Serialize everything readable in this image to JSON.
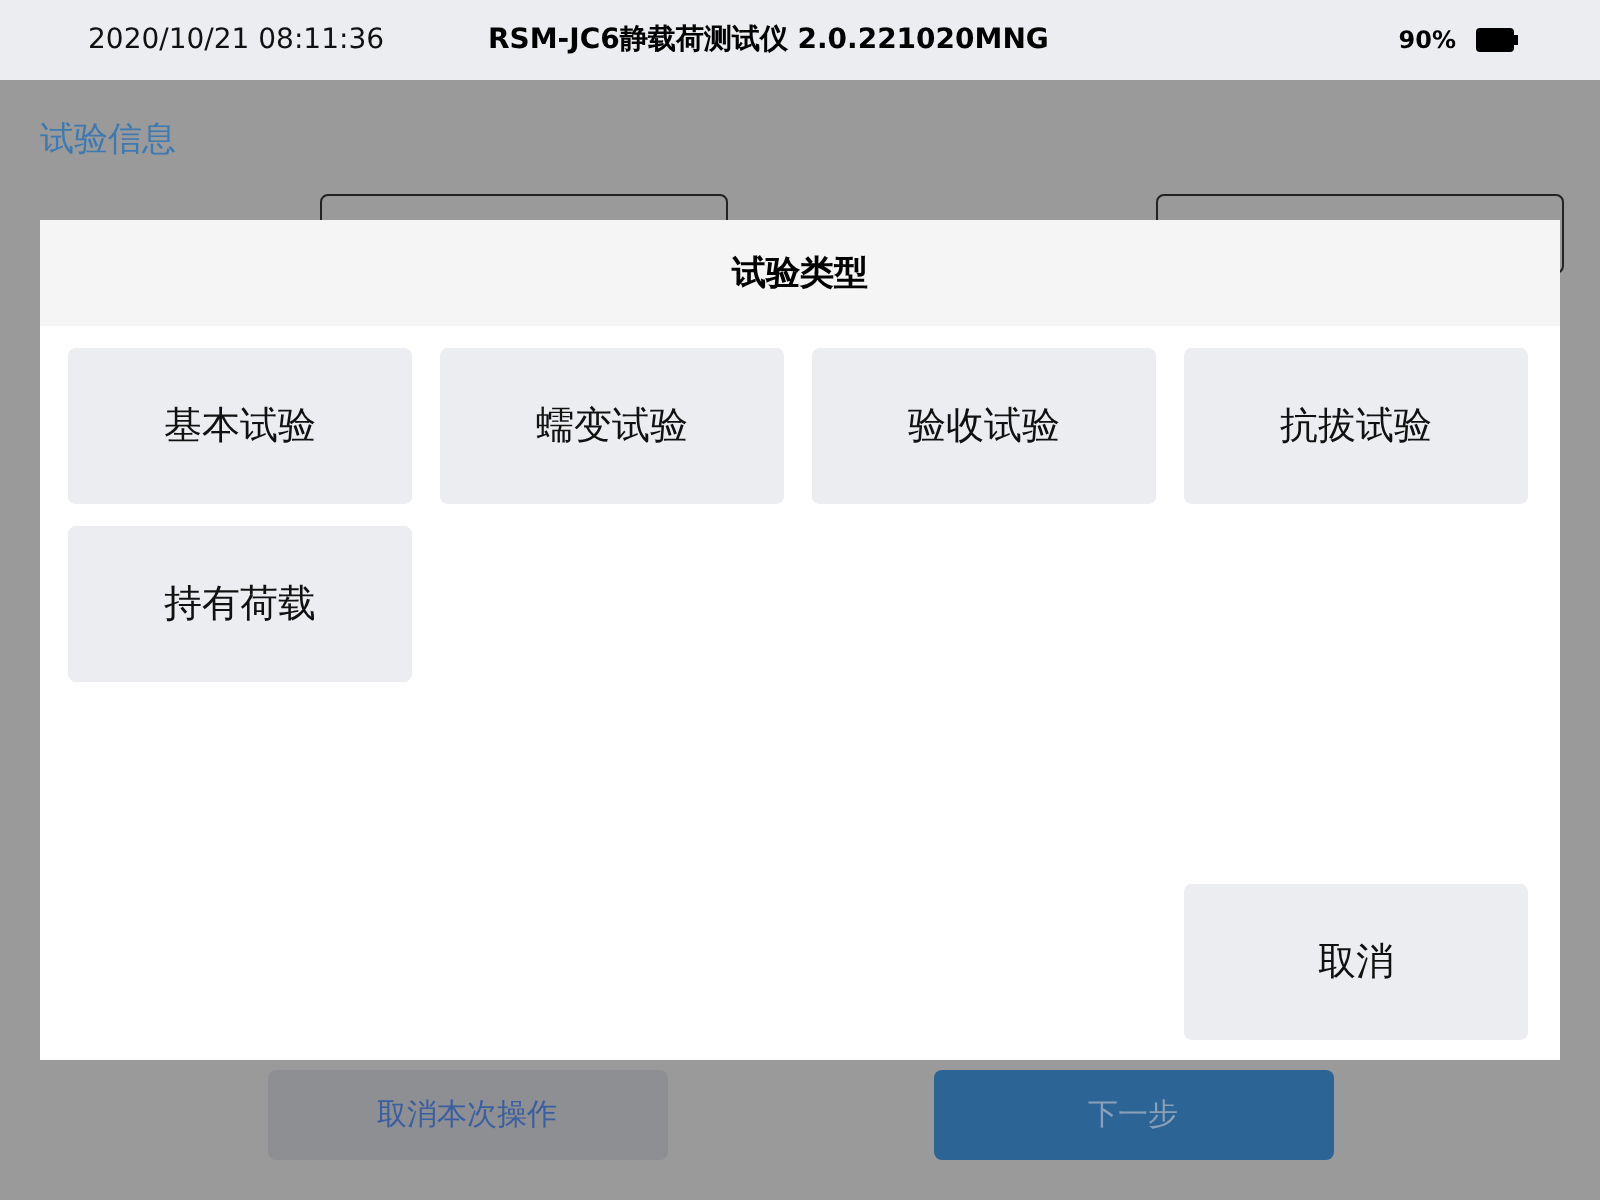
{
  "status_bar": {
    "datetime": "2020/10/21 08:11:36",
    "title": "RSM-JC6静载荷测试仪 2.0.221020MNG",
    "battery": "90%"
  },
  "page": {
    "section_title": "试验信息",
    "actions": [
      {
        "label": "取消本次操作",
        "kind": "secondary"
      },
      {
        "label": "下一步",
        "kind": "primary"
      }
    ]
  },
  "dialog": {
    "title": "试验类型",
    "options": [
      "基本试验",
      "蠕变试验",
      "验收试验",
      "抗拔试验",
      "持有荷载"
    ],
    "cancel": "取消"
  }
}
